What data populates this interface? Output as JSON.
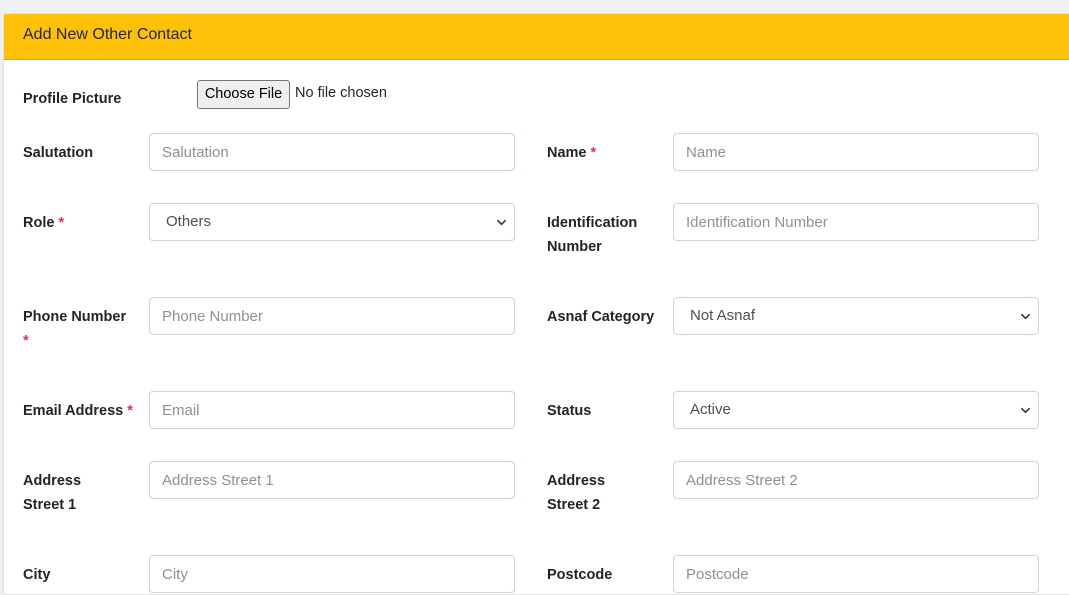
{
  "header": {
    "title": "Add New Other Contact"
  },
  "profile_picture": {
    "label": "Profile Picture",
    "button_label": "Choose File",
    "status": "No file chosen"
  },
  "salutation": {
    "label": "Salutation",
    "placeholder": "Salutation"
  },
  "name": {
    "label": "Name",
    "required": "*",
    "placeholder": "Name"
  },
  "role": {
    "label": "Role",
    "required": "*",
    "value": "Others"
  },
  "identification_number": {
    "label_line1": "Identification",
    "label_line2": "Number",
    "placeholder": "Identification Number"
  },
  "phone_number": {
    "label": "Phone Number",
    "required": "*",
    "placeholder": "Phone Number"
  },
  "asnaf_category": {
    "label": "Asnaf Category",
    "value": "Not Asnaf"
  },
  "email_address": {
    "label": "Email Address",
    "required": "*",
    "placeholder": "Email"
  },
  "status": {
    "label": "Status",
    "value": "Active"
  },
  "address_street_1": {
    "label_line1": "Address",
    "label_line2": "Street 1",
    "placeholder": "Address Street 1"
  },
  "address_street_2": {
    "label_line1": "Address",
    "label_line2": "Street 2",
    "placeholder": "Address Street 2"
  },
  "city": {
    "label": "City",
    "placeholder": "City"
  },
  "postcode": {
    "label": "Postcode",
    "placeholder": "Postcode"
  },
  "colors": {
    "header": "#ffc107",
    "required": "#dc3545",
    "border": "#ced4da"
  },
  "icons": {
    "select_arrow": "chevron-down-icon"
  }
}
